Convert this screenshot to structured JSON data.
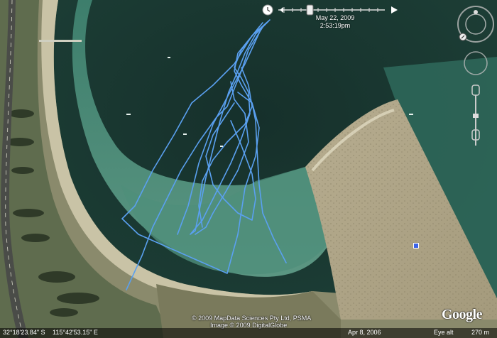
{
  "time_slider": {
    "date": "May 22, 2009",
    "time": "2:53:19pm"
  },
  "copyright": {
    "line1": "© 2009 MapData Sciences Pty Ltd, PSMA",
    "line2": "Image © 2009 DigitalGlobe"
  },
  "logo": "Google",
  "status_bar": {
    "latitude": "32°18'23.84\" S",
    "longitude": "115°42'53.15\" E",
    "imagery_date": "Apr 8, 2006",
    "eye_alt_label": "Eye alt",
    "eye_alt_value": "270 m"
  },
  "track": {
    "color": "#5aa0f0"
  },
  "icons": [
    "time-slider-clock-icon",
    "play-icon",
    "look-joystick-icon",
    "move-joystick-icon",
    "zoom-slider-icon",
    "placemark-icon"
  ]
}
